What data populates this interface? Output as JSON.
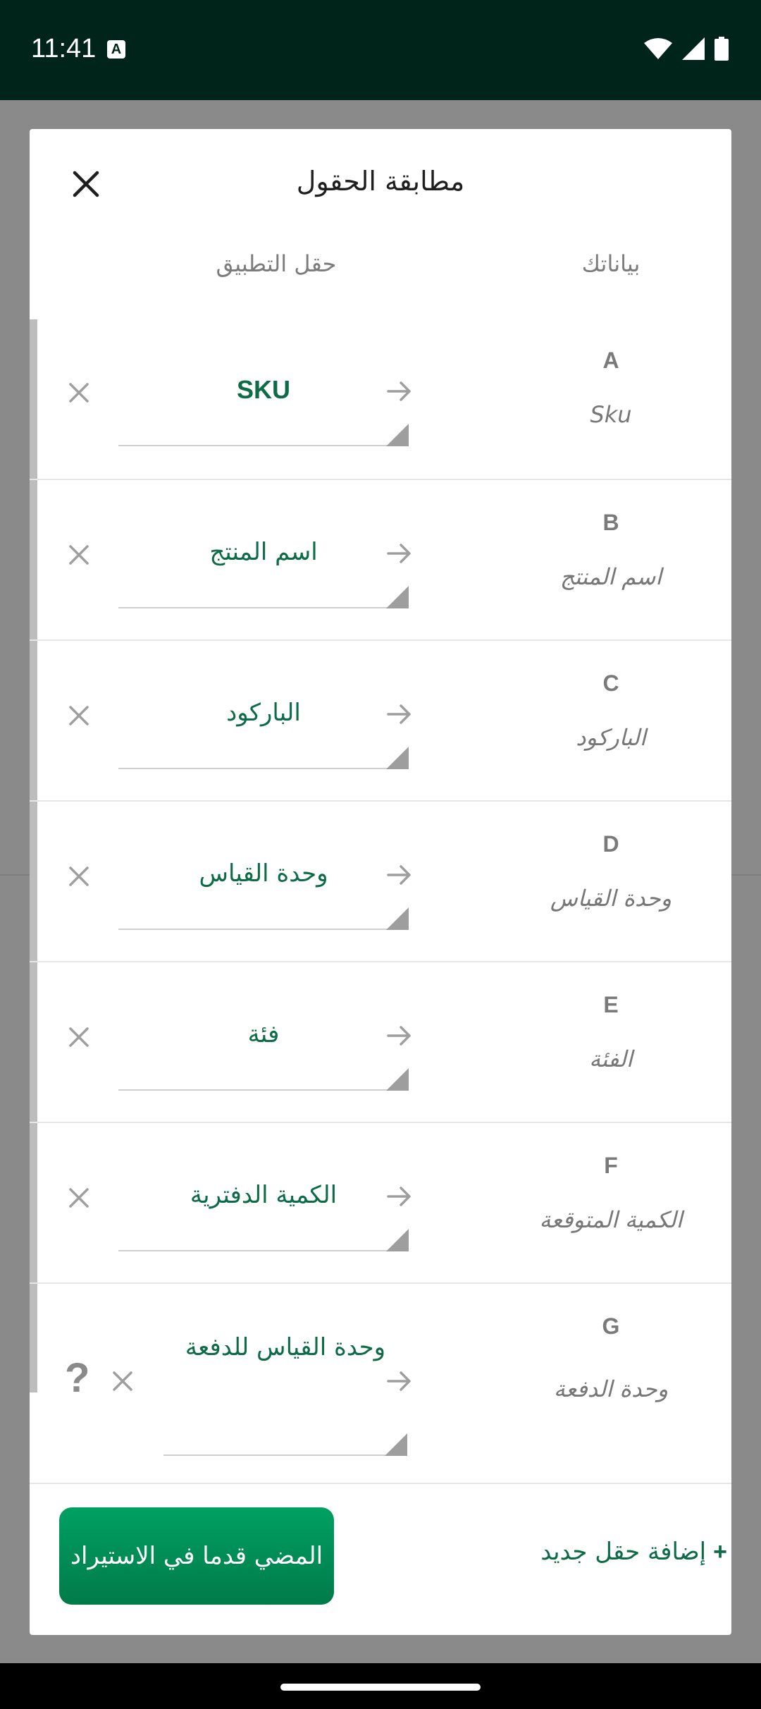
{
  "status_bar": {
    "time": "11:41",
    "notification_badge": "A",
    "icons": [
      "wifi-icon",
      "signal-icon",
      "battery-icon"
    ]
  },
  "dialog": {
    "title": "مطابقة الحقول",
    "close_icon": "close-icon",
    "column_your_data": "بياناتك",
    "column_app_field": "حقل التطبيق",
    "rows": [
      {
        "letter": "A",
        "source": "Sku",
        "field": "SKU"
      },
      {
        "letter": "B",
        "source": "اسم المنتج",
        "field": "اسم المنتج"
      },
      {
        "letter": "C",
        "source": "الباركود",
        "field": "الباركود"
      },
      {
        "letter": "D",
        "source": "وحدة القياس",
        "field": "وحدة القياس"
      },
      {
        "letter": "E",
        "source": "الفئة",
        "field": "فئة"
      },
      {
        "letter": "F",
        "source": "الكمية المتوقعة",
        "field": "الكمية الدفترية"
      },
      {
        "letter": "G",
        "source": "وحدة الدفعة",
        "field": "وحدة القياس للدفعة",
        "help": "?"
      }
    ],
    "add_field_plus": "+",
    "add_field_label": "إضافة حقل جديد",
    "continue_label": "المضي قدما في الاستيراد"
  },
  "colors": {
    "accent": "#0d6b47",
    "button": "#00a062",
    "status_bar": "#00231a"
  }
}
